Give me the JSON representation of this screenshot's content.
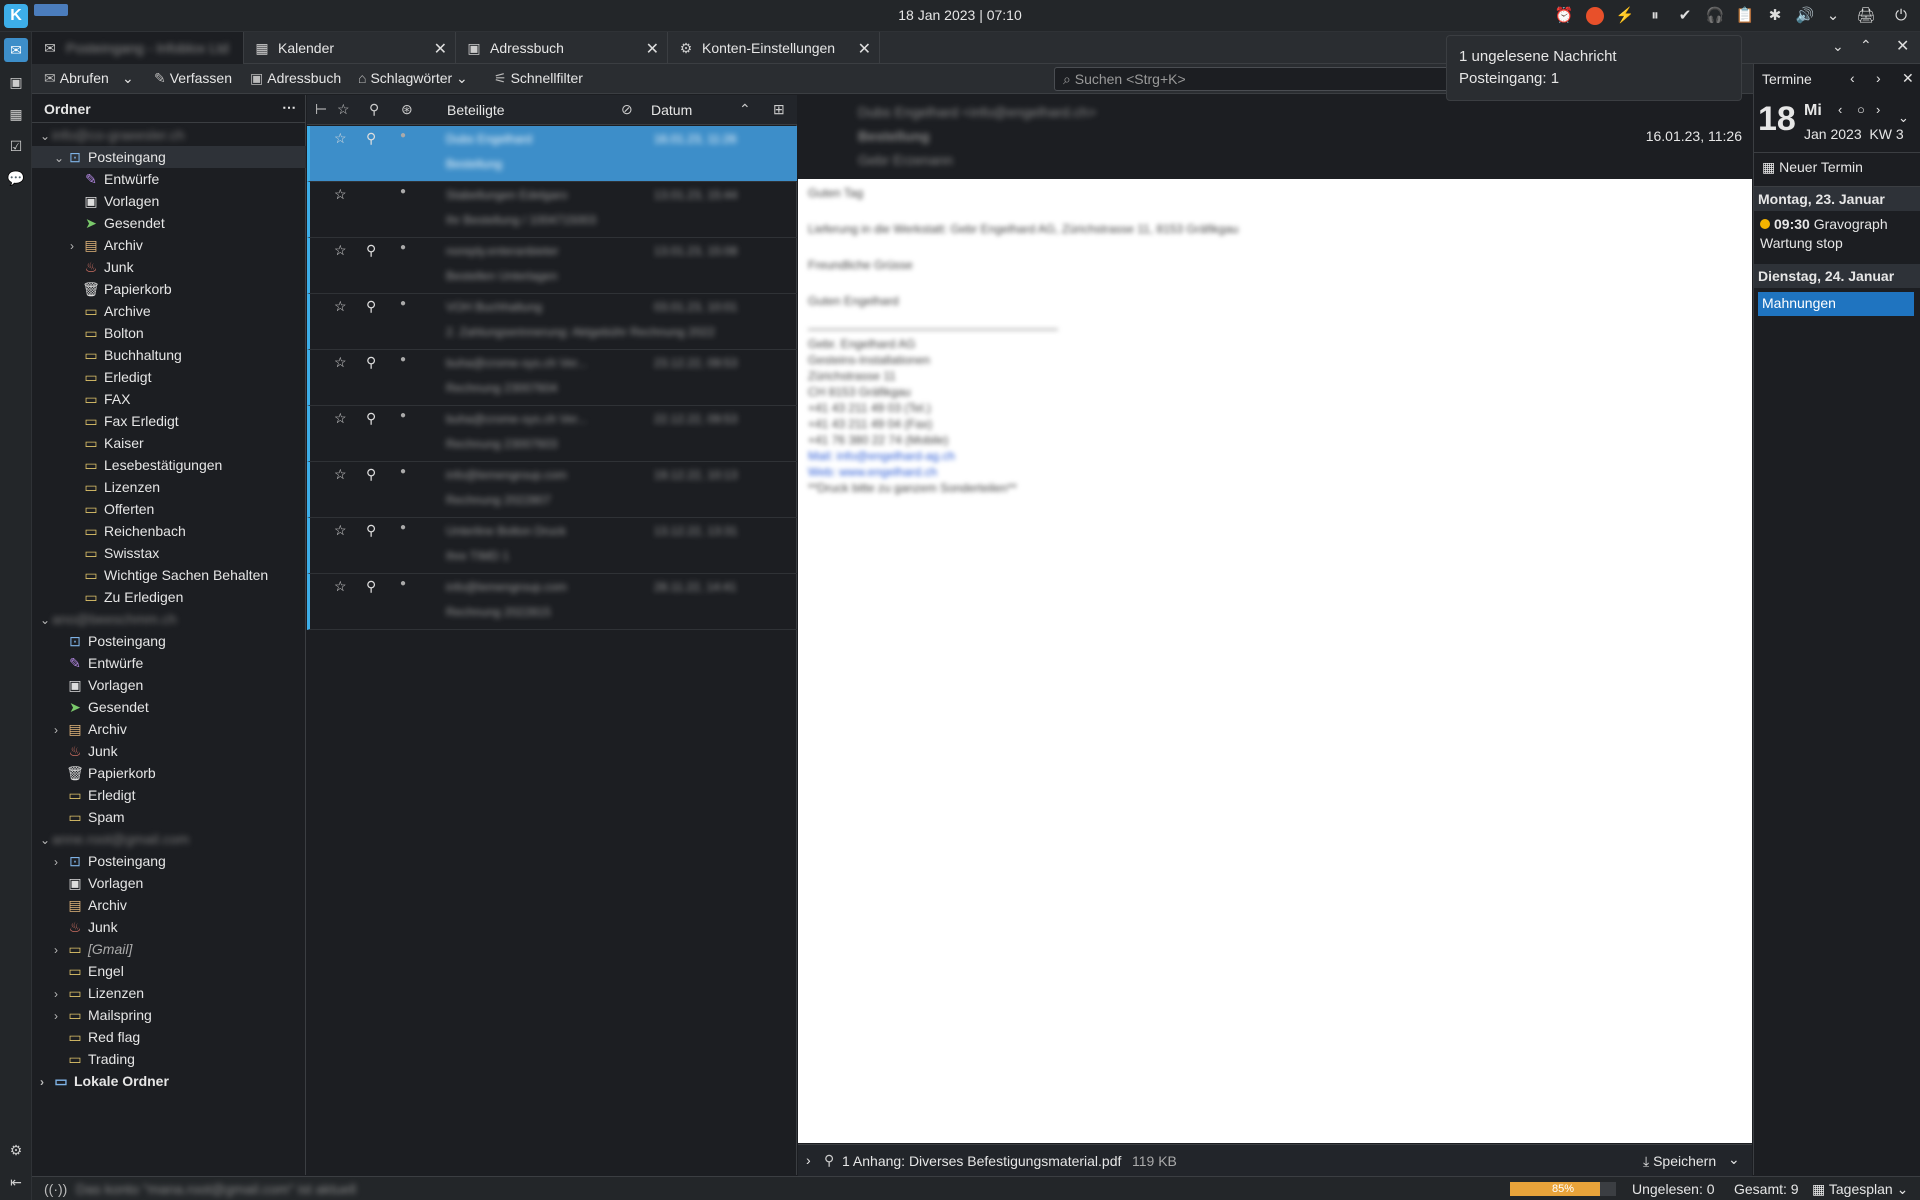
{
  "topbar": {
    "clock": "18 Jan 2023 | 07:10",
    "kde_logo": "K"
  },
  "tabs": [
    {
      "label": "Posteingang - Infoblox Ltd",
      "icon": "mail-icon"
    },
    {
      "label": "Kalender",
      "icon": "calendar-icon"
    },
    {
      "label": "Adressbuch",
      "icon": "address-book-icon"
    },
    {
      "label": "Konten-Einstellungen",
      "icon": "settings-icon"
    }
  ],
  "toolbar": {
    "fetch": "Abrufen",
    "compose": "Verfassen",
    "addressbook": "Adressbuch",
    "tags": "Schlagwörter",
    "quickfilter": "Schnellfilter",
    "search_placeholder": "Suchen <Strg+K>"
  },
  "folderpane": {
    "title": "Ordner",
    "account1": {
      "name": "info@co-graeesler.ch",
      "inbox": "Posteingang",
      "folders": [
        "Entwürfe",
        "Vorlagen",
        "Gesendet",
        "Archiv",
        "Junk",
        "Papierkorb",
        "Archive",
        "Bolton",
        "Buchhaltung",
        "Erledigt",
        "FAX",
        "Fax Erledigt",
        "Kaiser",
        "Lesebestätigungen",
        "Lizenzen",
        "Offerten",
        "Reichenbach",
        "Swisstax",
        "Wichtige Sachen Behalten",
        "Zu Erledigen"
      ]
    },
    "account2": {
      "name": "ano@beeschmm.ch",
      "folders": [
        "Posteingang",
        "Entwürfe",
        "Vorlagen",
        "Gesendet",
        "Archiv",
        "Junk",
        "Papierkorb",
        "Erledigt",
        "Spam"
      ]
    },
    "account3": {
      "name": "anne.root@gmail.com",
      "folders": [
        "Posteingang",
        "Vorlagen",
        "Archiv",
        "Junk",
        "[Gmail]",
        "Engel",
        "Lizenzen",
        "Mailspring",
        "Red flag",
        "Trading"
      ]
    },
    "local": "Lokale Ordner"
  },
  "msglist": {
    "col_participants": "Beteiligte",
    "col_date": "Datum",
    "rows": [
      {
        "from": "Dubs Engelhard",
        "subject": "Bestellung",
        "date": "16.01.23, 11:26",
        "selected": true
      },
      {
        "from": "Stabellungen Edelgaro",
        "subject": "Ihr Bestellung / 1004715003",
        "date": "13.01.23, 15:44"
      },
      {
        "from": "noreply.enteranbieter",
        "subject": "Bestellen Unterlagen",
        "date": "13.01.23, 15:08"
      },
      {
        "from": "VOH Buchhaltung",
        "subject": "2. Zahlungserinnerung: Aktgebühr Rechnung 2022",
        "date": "03.01.23, 10:01"
      },
      {
        "from": "buha@crome-sys.ch Ver...",
        "subject": "Rechnung 23007604",
        "date": "23.12.22, 09:53"
      },
      {
        "from": "buha@crome-sys.ch Ver...",
        "subject": "Rechnung 23007603",
        "date": "22.12.22, 09:53"
      },
      {
        "from": "info@lemengroup.com",
        "subject": "Rechnung 2022807",
        "date": "19.12.22, 10:13"
      },
      {
        "from": "Unterline Bolton Druck",
        "subject": "Ihre TIMD 1",
        "date": "13.12.22, 13:31"
      },
      {
        "from": "info@lemengroup.com",
        "subject": "Rechnung 2022815",
        "date": "28.11.22, 14:41"
      }
    ]
  },
  "message": {
    "from": "Dubs Engelhard <info@engelhard.ch>",
    "subject": "Bestellung",
    "to": "Gebr Erzenann",
    "date": "16.01.23, 11:26",
    "body_lines": [
      "Guten Tag",
      "Lieferung in die Werkstatt: Gebr Engelhard AG, Zürichstrasse 11, 8153 Gräfikgau",
      "Freundliche Grüsse",
      "Guten Engelhard"
    ],
    "signature": [
      "Gebr. Engelhard AG",
      "Gesteins-Installationen",
      "Zürichstrasse 11",
      "CH 8153 Gräfikgau",
      "+41 43 211 49 03 (Tel.)",
      "+41 43 211 49 04 (Fax)",
      "+41 76 380 22 74 (Mobile)",
      "Mail: info@engelhard-ag.ch",
      "Web: www.engelhard.ch",
      "**Druck bitte zu ganzem Sonderteilen**"
    ]
  },
  "attachment": {
    "text": "1 Anhang: Diverses Befestigungsmaterial.pdf",
    "size": "119 KB",
    "save": "Speichern"
  },
  "today": {
    "title": "Termine",
    "day_number": "18",
    "weekday": "Mi",
    "month_year": "Jan 2023",
    "week": "KW 3",
    "new_event": "Neuer Termin",
    "day1": "Montag, 23. Januar",
    "event1_time": "09:30",
    "event1_title": "Gravograph Wartung stop",
    "day2": "Dienstag, 24. Januar",
    "event2_title": "Mahnungen"
  },
  "notification": {
    "line1": "1 ungelesene Nachricht",
    "line2": "Posteingang: 1"
  },
  "status": {
    "account_text": "Das konto \"mana.root@gmail.com\" ist aktuell",
    "progress": 0.85,
    "progress_label": "85%",
    "unread": "Ungelesen: 0",
    "total": "Gesamt: 9",
    "view": "Tagesplan"
  },
  "colors": {
    "accent": "#3daee9",
    "selection": "#3d8ec9",
    "event_today": "#1f74c0",
    "event_dot": "#f5b400"
  }
}
